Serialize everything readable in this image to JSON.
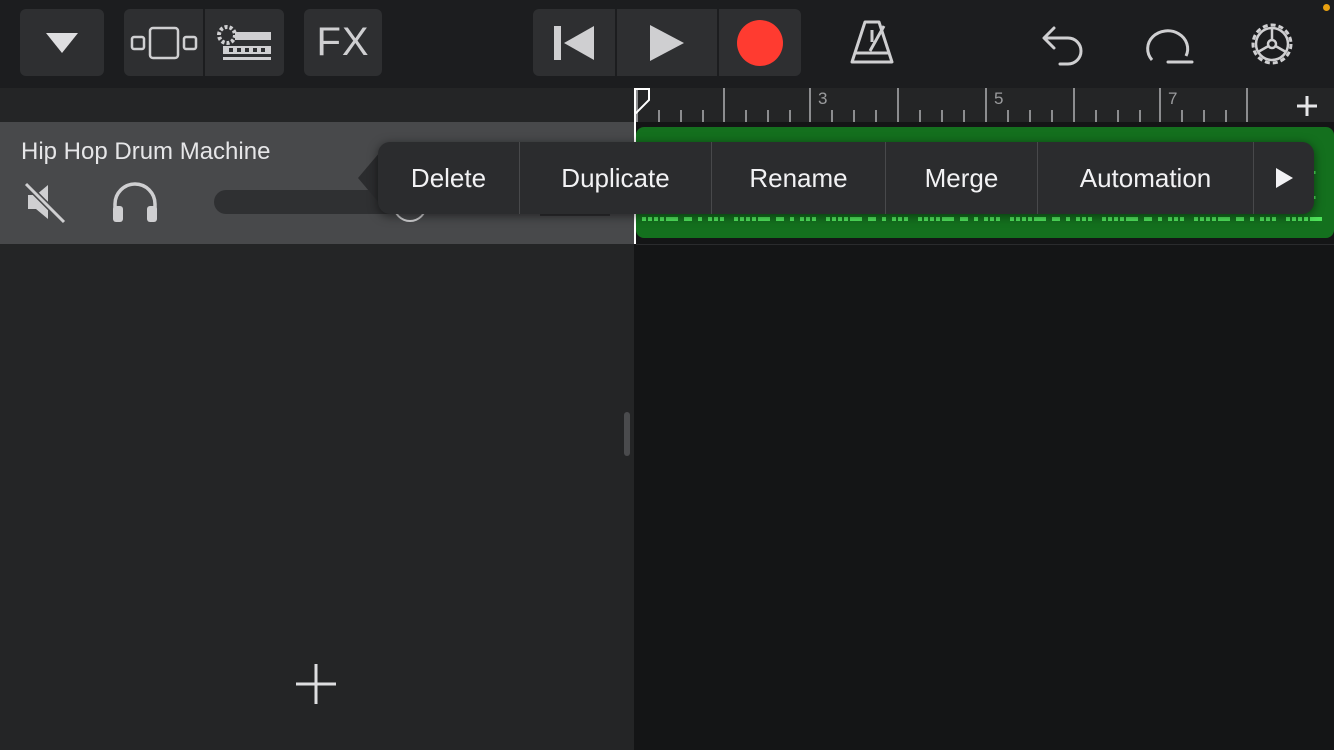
{
  "toolbar": {
    "browser_icon": "triangle-down-icon",
    "tracks_view_icon": "tracks-view-icon",
    "mixer_icon": "mixer-icon",
    "fx_label": "FX",
    "rewind_icon": "go-to-beginning-icon",
    "play_icon": "play-icon",
    "record_icon": "record-icon",
    "metronome_icon": "metronome-icon",
    "undo_icon": "undo-icon",
    "loop_icon": "loop-browser-icon",
    "settings_icon": "settings-gear-icon"
  },
  "ruler": {
    "labels": [
      "3",
      "5",
      "7"
    ],
    "add_icon": "plus-icon"
  },
  "track": {
    "name": "Hip Hop Drum Machine",
    "mute_icon": "speaker-muted-icon",
    "solo_icon": "headphones-icon"
  },
  "context_menu": {
    "items": [
      "Delete",
      "Duplicate",
      "Rename",
      "Merge",
      "Automation"
    ],
    "more_icon": "triangle-right-icon"
  },
  "add_track_icon": "plus-icon",
  "colors": {
    "record": "#ff3b30",
    "region": "#14701e",
    "midi_notes": "#4ee25a",
    "status_dot": "#e8a010"
  }
}
